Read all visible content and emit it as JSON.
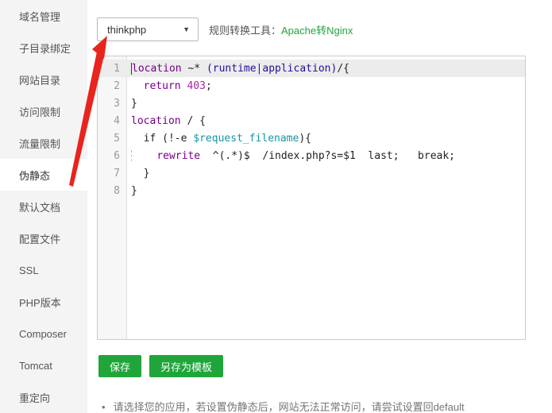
{
  "sidebar": {
    "items": [
      {
        "key": "domain-management",
        "label": "域名管理",
        "selected": false
      },
      {
        "key": "subdirectory-binding",
        "label": "子目录绑定",
        "selected": false
      },
      {
        "key": "site-directory",
        "label": "网站目录",
        "selected": false
      },
      {
        "key": "access-restriction",
        "label": "访问限制",
        "selected": false
      },
      {
        "key": "traffic-limit",
        "label": "流量限制",
        "selected": false
      },
      {
        "key": "pseudo-static",
        "label": "伪静态",
        "selected": true
      },
      {
        "key": "default-document",
        "label": "默认文档",
        "selected": false
      },
      {
        "key": "config-file",
        "label": "配置文件",
        "selected": false
      },
      {
        "key": "ssl",
        "label": "SSL",
        "selected": false
      },
      {
        "key": "php-version",
        "label": "PHP版本",
        "selected": false
      },
      {
        "key": "composer",
        "label": "Composer",
        "selected": false
      },
      {
        "key": "tomcat",
        "label": "Tomcat",
        "selected": false
      },
      {
        "key": "redirect",
        "label": "重定向",
        "selected": false
      }
    ]
  },
  "toolbar": {
    "select_value": "thinkphp",
    "caret_icon": "▼",
    "convert_label": "规则转换工具：",
    "convert_link": "Apache转Nginx"
  },
  "editor": {
    "lines": [
      {
        "num": 1,
        "active": true,
        "segments": [
          {
            "t": "",
            "c": "cursor"
          },
          {
            "t": "location",
            "c": "keyword"
          },
          {
            "t": " ~* ",
            "c": "plain"
          },
          {
            "t": "(runtime|application)",
            "c": "atom"
          },
          {
            "t": "/{",
            "c": "plain"
          }
        ]
      },
      {
        "num": 2,
        "active": false,
        "segments": [
          {
            "t": "  ",
            "c": "plain"
          },
          {
            "t": "return",
            "c": "keyword"
          },
          {
            "t": " ",
            "c": "plain"
          },
          {
            "t": "403",
            "c": "number"
          },
          {
            "t": ";",
            "c": "plain"
          }
        ]
      },
      {
        "num": 3,
        "active": false,
        "segments": [
          {
            "t": "}",
            "c": "plain"
          }
        ]
      },
      {
        "num": 4,
        "active": false,
        "segments": [
          {
            "t": "location",
            "c": "keyword"
          },
          {
            "t": " / {",
            "c": "plain"
          }
        ]
      },
      {
        "num": 5,
        "active": false,
        "segments": [
          {
            "t": "  if (!-e ",
            "c": "plain"
          },
          {
            "t": "$request_filename",
            "c": "variable"
          },
          {
            "t": "){",
            "c": "plain"
          }
        ]
      },
      {
        "num": 6,
        "active": false,
        "segments": [
          {
            "t": "",
            "c": "guide"
          },
          {
            "t": "    ",
            "c": "plain"
          },
          {
            "t": "rewrite",
            "c": "keyword"
          },
          {
            "t": "  ^(.*)$  /index.php?s=$1  last;   break;",
            "c": "plain"
          }
        ]
      },
      {
        "num": 7,
        "active": false,
        "segments": [
          {
            "t": "  }",
            "c": "plain"
          }
        ]
      },
      {
        "num": 8,
        "active": false,
        "segments": [
          {
            "t": "}",
            "c": "plain"
          }
        ]
      }
    ]
  },
  "buttons": {
    "save": "保存",
    "save_as_template": "另存为模板"
  },
  "note": {
    "bullet": "•",
    "text": "请选择您的应用，若设置伪静态后，网站无法正常访问，请尝试设置回default"
  },
  "colors": {
    "accent_green": "#20a53a",
    "arrow_red": "#e8241d",
    "sidebar_bg": "#f4f4f4",
    "active_line_bg": "#ececec"
  }
}
